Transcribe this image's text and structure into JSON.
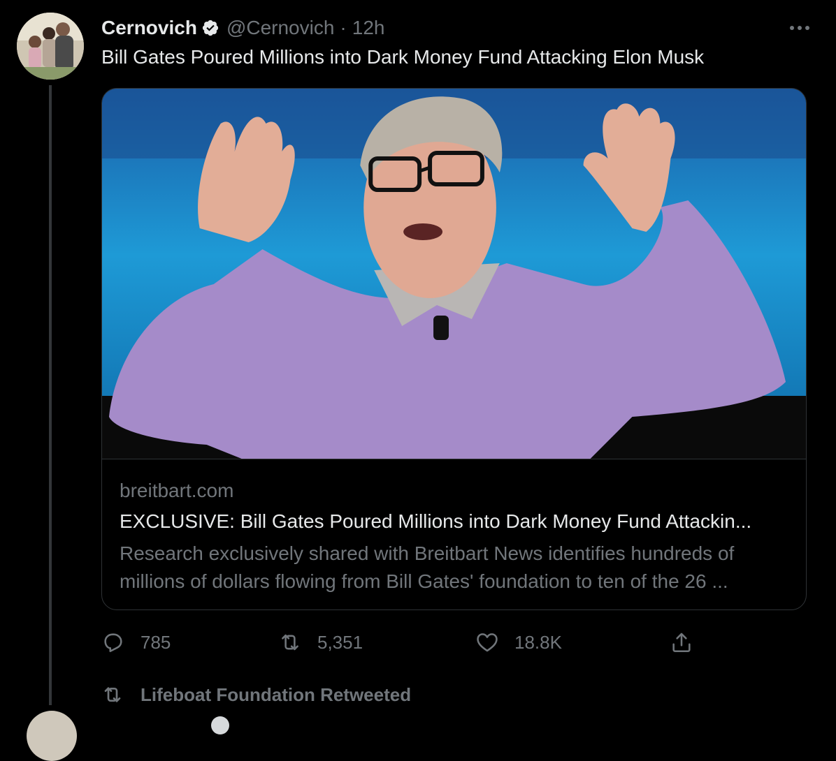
{
  "tweet": {
    "author_name": "Cernovich",
    "handle": "@Cernovich",
    "separator": "·",
    "time": "12h",
    "text": "Bill Gates Poured Millions into Dark Money Fund Attacking Elon Musk",
    "more_icon": "more-horizontal-icon",
    "verified_icon": "verified-badge-icon"
  },
  "card": {
    "domain": "breitbart.com",
    "title": "EXCLUSIVE: Bill Gates Poured Millions into Dark Money Fund Attackin...",
    "description": "Research exclusively shared with Breitbart News identifies hundreds of millions of dollars flowing from Bill Gates' foundation to ten of the 26 ..."
  },
  "actions": {
    "reply_count": "785",
    "retweet_count": "5,351",
    "like_count": "18.8K",
    "reply_icon": "reply-icon",
    "retweet_icon": "retweet-icon",
    "like_icon": "heart-icon",
    "share_icon": "share-icon"
  },
  "next": {
    "retweeted_by": "Lifeboat Foundation Retweeted"
  },
  "colors": {
    "background": "#000000",
    "text_primary": "#e7e9ea",
    "text_secondary": "#71767b",
    "border": "#2f3336"
  }
}
